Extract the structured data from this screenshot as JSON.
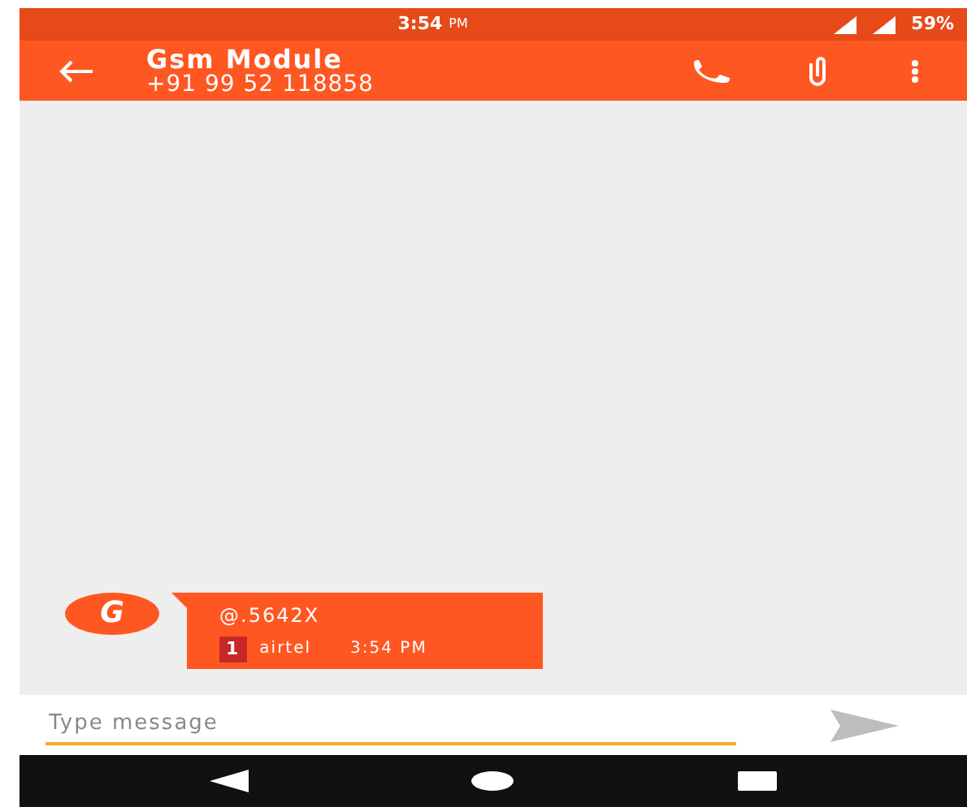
{
  "status_bar": {
    "time": "3:54",
    "ampm": "PM",
    "battery": "59%"
  },
  "toolbar": {
    "title": "Gsm Module",
    "subtitle": "+91 99 52 118858"
  },
  "messages": [
    {
      "avatar": "G",
      "text": "@.5642X",
      "sim": "1",
      "carrier": "airtel",
      "time": "3:54 PM"
    }
  ],
  "composer": {
    "placeholder": "Type message"
  }
}
